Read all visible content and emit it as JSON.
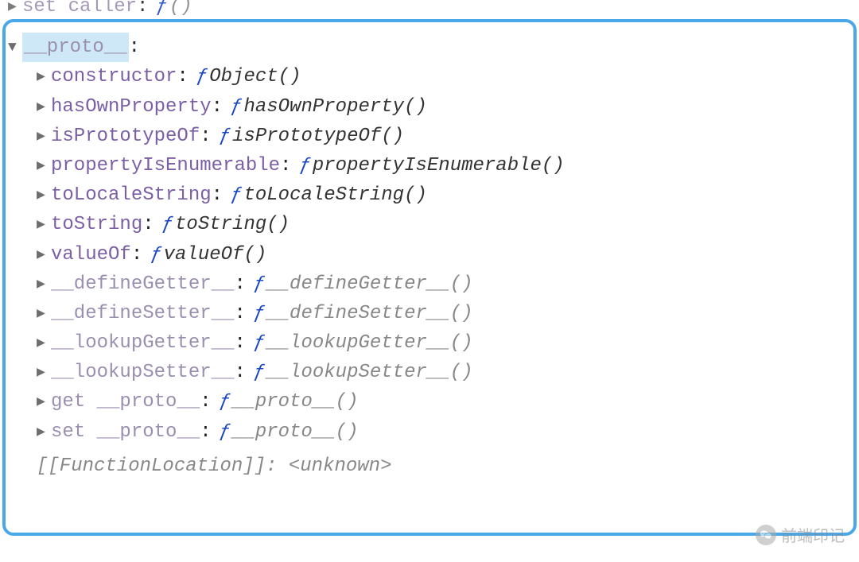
{
  "partial_top": {
    "name": "set caller",
    "f": "ƒ",
    "fn": "()"
  },
  "proto_header": {
    "name": "__proto__"
  },
  "props": [
    {
      "name": "constructor",
      "f": "ƒ",
      "fn": "Object()",
      "dimmed": false
    },
    {
      "name": "hasOwnProperty",
      "f": "ƒ",
      "fn": "hasOwnProperty()",
      "dimmed": false
    },
    {
      "name": "isPrototypeOf",
      "f": "ƒ",
      "fn": "isPrototypeOf()",
      "dimmed": false
    },
    {
      "name": "propertyIsEnumerable",
      "f": "ƒ",
      "fn": "propertyIsEnumerable()",
      "dimmed": false
    },
    {
      "name": "toLocaleString",
      "f": "ƒ",
      "fn": "toLocaleString()",
      "dimmed": false
    },
    {
      "name": "toString",
      "f": "ƒ",
      "fn": "toString()",
      "dimmed": false
    },
    {
      "name": "valueOf",
      "f": "ƒ",
      "fn": "valueOf()",
      "dimmed": false
    },
    {
      "name": "__defineGetter__",
      "f": "ƒ",
      "fn": "__defineGetter__()",
      "dimmed": true
    },
    {
      "name": "__defineSetter__",
      "f": "ƒ",
      "fn": "__defineSetter__()",
      "dimmed": true
    },
    {
      "name": "__lookupGetter__",
      "f": "ƒ",
      "fn": "__lookupGetter__()",
      "dimmed": true
    },
    {
      "name": "__lookupSetter__",
      "f": "ƒ",
      "fn": "__lookupSetter__()",
      "dimmed": true
    },
    {
      "name": "get __proto__",
      "f": "ƒ",
      "fn": "__proto__()",
      "dimmed": true
    },
    {
      "name": "set __proto__",
      "f": "ƒ",
      "fn": "__proto__()",
      "dimmed": true
    }
  ],
  "partial_bottom": {
    "text": "[[FunctionLocation]]: <unknown>"
  },
  "watermark": {
    "label": "前端印记"
  }
}
